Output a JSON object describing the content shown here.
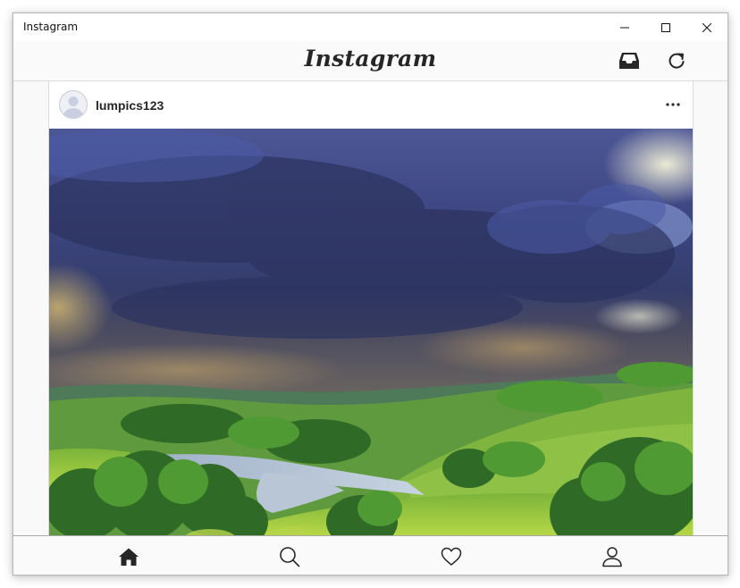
{
  "window": {
    "title": "Instagram",
    "controls": [
      "minimize",
      "maximize",
      "close"
    ]
  },
  "header": {
    "logo": "Instagram",
    "actions": [
      {
        "icon": "inbox-icon",
        "label": ""
      },
      {
        "icon": "refresh-icon",
        "label": ""
      }
    ]
  },
  "post": {
    "username": "lumpics123",
    "avatar": "default-avatar",
    "options_icon": "more-options-icon",
    "image": "landscape photo: dark stormy clouds over green hills and a river valley"
  },
  "bottom_nav": [
    {
      "icon": "home-icon",
      "active": true
    },
    {
      "icon": "search-icon",
      "active": false
    },
    {
      "icon": "heart-icon",
      "active": false
    },
    {
      "icon": "profile-icon",
      "active": false
    }
  ],
  "colors": {
    "text": "#262626",
    "border": "#dbdbdb",
    "bar_background": "#fafafa"
  }
}
